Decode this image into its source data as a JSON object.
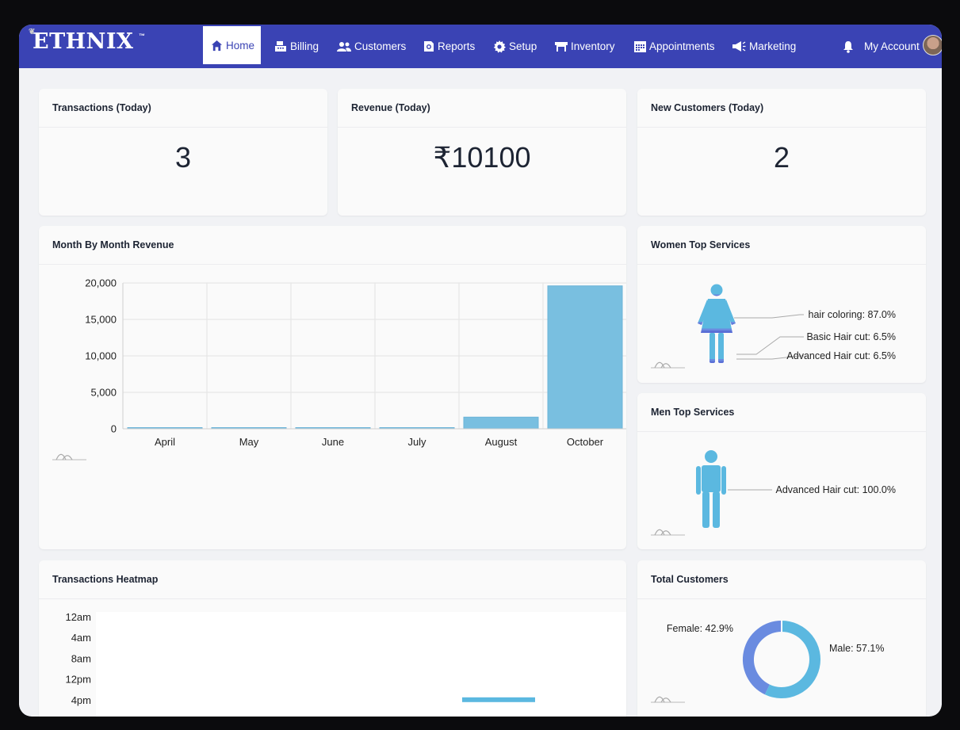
{
  "nav": {
    "brand": "ETHNIX",
    "tm": "™",
    "items": [
      {
        "label": "Home",
        "icon": "home-icon"
      },
      {
        "label": "Billing",
        "icon": "cash-register-icon"
      },
      {
        "label": "Customers",
        "icon": "users-icon"
      },
      {
        "label": "Reports",
        "icon": "report-search-icon"
      },
      {
        "label": "Setup",
        "icon": "gear-icon"
      },
      {
        "label": "Inventory",
        "icon": "store-icon"
      },
      {
        "label": "Appointments",
        "icon": "calendar-icon"
      },
      {
        "label": "Marketing",
        "icon": "megaphone-icon"
      }
    ],
    "account_label": "My Account",
    "bell_icon": "bell-icon",
    "accent_color": "#3a43b4"
  },
  "stats": {
    "transactions": {
      "title": "Transactions (Today)",
      "value": "3"
    },
    "revenue": {
      "title": "Revenue (Today)",
      "value": "₹10100"
    },
    "new_customers": {
      "title": "New Customers (Today)",
      "value": "2"
    }
  },
  "cards": {
    "monthly_revenue": "Month By Month Revenue",
    "women_services": "Women Top Services",
    "men_services": "Men Top Services",
    "heatmap": "Transactions Heatmap",
    "total_customers": "Total Customers"
  },
  "chart_data": [
    {
      "type": "bar",
      "categories": [
        "April",
        "May",
        "June",
        "July",
        "August",
        "October"
      ],
      "values": [
        50,
        50,
        50,
        50,
        1600,
        19600
      ],
      "ylim": [
        0,
        20000
      ],
      "yticks": [
        0,
        5000,
        10000,
        15000,
        20000
      ],
      "ytick_labels": [
        "0",
        "5,000",
        "10,000",
        "15,000",
        "20,000"
      ],
      "grid": true,
      "bar_color": "#79bfe0"
    },
    {
      "type": "pie",
      "labels": [
        "hair coloring: 87.0%",
        "Basic Hair cut: 6.5%",
        "Advanced Hair cut: 6.5%"
      ],
      "categories": [
        "hair coloring",
        "Basic Hair cut",
        "Advanced Hair cut"
      ],
      "values": [
        87.0,
        6.5,
        6.5
      ],
      "colors": [
        "#5bb8e0",
        "#6a8be0",
        "#5a6fd6"
      ]
    },
    {
      "type": "pie",
      "labels": [
        "Advanced Hair cut: 100.0%"
      ],
      "categories": [
        "Advanced Hair cut"
      ],
      "values": [
        100.0
      ],
      "colors": [
        "#5bb8e0"
      ]
    },
    {
      "type": "heatmap",
      "y_labels": [
        "12am",
        "4am",
        "8am",
        "12pm",
        "4pm"
      ],
      "highlight": {
        "row": "4pm",
        "value": 3
      },
      "color": "#5bb8e0"
    },
    {
      "type": "pie",
      "labels": [
        "Female: 42.9%",
        "Male: 57.1%"
      ],
      "categories": [
        "Female",
        "Male"
      ],
      "values": [
        42.9,
        57.1
      ],
      "colors": [
        "#6a8be0",
        "#5bb8e0"
      ]
    }
  ]
}
